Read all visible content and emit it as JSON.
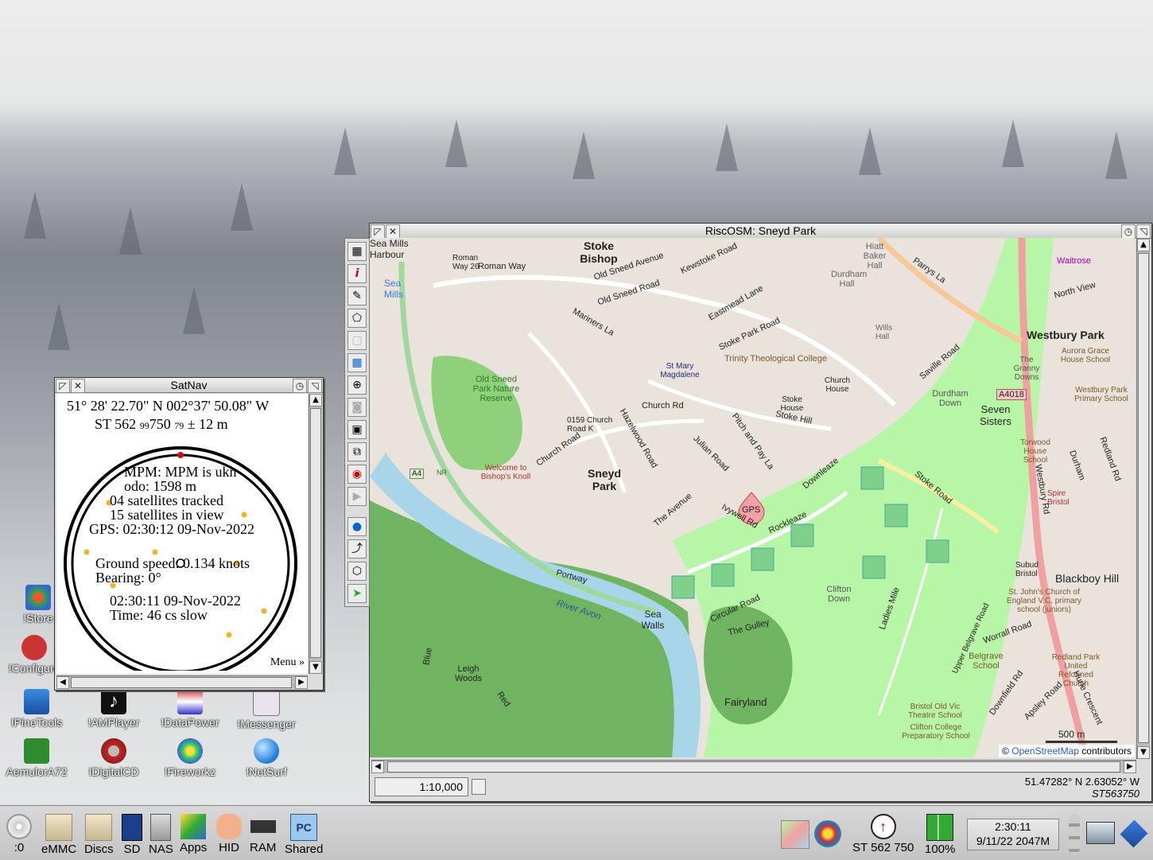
{
  "satnav": {
    "title": "SatNav",
    "coords": "51° 28' 22.70\" N  002°37' 50.08\" W",
    "grid_prefix": "ST 562",
    "grid_small1": "99",
    "grid_mid": "750",
    "grid_small2": "79",
    "grid_suffix": "±  12 m",
    "mpm": "MPM:   MPM is ukn",
    "odo": "odo:      1598 m",
    "tracked": "04 satellites tracked",
    "inview": "15 satellites in view",
    "gps": "GPS: 02:30:12 09-Nov-2022",
    "speed": "Ground speed: 0.134 knots",
    "bearing": "Bearing:     0°",
    "clock": "02:30:11 09-Nov-2022",
    "time": "Time:     46 cs slow",
    "menu": "Menu »"
  },
  "map_window": {
    "title": "RiscOSM: Sneyd Park",
    "scale": "1:10,000",
    "lat_lon": "51.47282° N  2.63052° W",
    "grid_ref": "ST563750",
    "attribution_prefix": "©",
    "attribution_link": "OpenStreetMap",
    "attribution_suffix": "contributors",
    "scale_bar": "500 m",
    "gps_marker": "GPS",
    "labels": {
      "stoke_bishop": "Stoke Bishop",
      "sea_mills_harbour": "Sea Mills Harbour",
      "sea_mills": "Sea Mills",
      "roman_way": "Roman Way",
      "roman_way_26": "Roman Way 26",
      "old_sneed_avenue": "Old Sneed Avenue",
      "old_sneed_road": "Old Sneed Road",
      "kewstoke_road": "Kewstoke Road",
      "durdham_hall": "Durdham Hall",
      "hiatt_baker_hall": "Hiatt Baker Hall",
      "waitrose": "Waitrose",
      "parrys_la": "Parrys La",
      "north_view": "North View",
      "westbury_park": "Westbury Park",
      "mariners": "Mariners La",
      "eastmead_lane": "Eastmead Lane",
      "stoke_park_road": "Stoke Park Road",
      "trinity": "Trinity Theological College",
      "church_rd": "Church Rd",
      "stoke_hill": "Stoke Hill",
      "saville_road": "Saville Road",
      "durdham_down": "Durdham Down",
      "seven_sisters": "Seven Sisters",
      "aurora": "Aurora Grace House School",
      "westbury_primary": "Westbury Park Primary School",
      "a4018": "A4018",
      "old_sneed_park": "Old Sneed Park Nature Reserve",
      "sneyd_park": "Sneyd Park",
      "church_road": "Church Road",
      "hazelwood": "Hazelwood Road",
      "pitch_pay": "Pitch and Pay La",
      "julian_road": "Julian Road",
      "downleaze": "Downleaze",
      "stoke_road": "Stoke Road",
      "torwood": "Torwood House School",
      "spire": "Spire Bristol",
      "the_avenue": "The Avenue",
      "ivywell": "Ivywell Rd",
      "rockleaze": "Rockleaze",
      "clifton_down": "Clifton Down",
      "ladies_mile": "Ladies Mile",
      "subud": "Subud Bristol",
      "blackboy": "Blackboy Hill",
      "st_johns": "St. John's Church of England V.C. primary school (juniors)",
      "portway": "Portway",
      "river_avon": "River Avon",
      "sea_walls": "Sea Walls",
      "circular_road": "Circular Road",
      "the_gulley": "The Gulley",
      "fairyland": "Fairyland",
      "leigh_woods": "Leigh Woods",
      "blue": "Blue",
      "red": "Red",
      "bishops_knoll": "Welcome to Bishop's Knoll",
      "worrall": "Worrall Road",
      "belgrave": "Belgrave School",
      "redland_park": "Redland Park United Reformed Church",
      "upper_belgrave": "Upper Belgrave Road",
      "bristol_old_vic": "Bristol Old Vic Theatre School",
      "clifton_college": "Clifton College Preparatory School",
      "a4": "A4",
      "stoke_house": "Stoke House",
      "church_house": "Church House",
      "st_mary": "St Mary Magdalene",
      "wills_hall": "Wills Hall",
      "the_granny": "The Granny Downs",
      "durham": "Durham",
      "redland_rd": "Redland Rd",
      "westbury_rd": "Westbury Rd",
      "hurle": "Hurle Crescent",
      "apsley": "Apsley Road",
      "downfield": "Downfield Rd",
      "church_0159": "0159 Church Road K",
      "nr": "NR"
    }
  },
  "desktop_icons": [
    {
      "label": "!Store"
    },
    {
      "label": "!Configure"
    },
    {
      "label": "!PineTools"
    },
    {
      "label": "!AMPlayer"
    },
    {
      "label": "!DataPower"
    },
    {
      "label": "!Messenger"
    },
    {
      "label": "AemulorA72"
    },
    {
      "label": "!DigitalCD"
    },
    {
      "label": "!Fireworkz"
    },
    {
      "label": "!NetSurf"
    }
  ],
  "iconbar": {
    "left": [
      {
        "label": ":0"
      },
      {
        "label": "eMMC"
      },
      {
        "label": "Discs"
      },
      {
        "label": "SD"
      },
      {
        "label": "NAS"
      },
      {
        "label": "Apps"
      },
      {
        "label": "HID"
      },
      {
        "label": "RAM"
      },
      {
        "label": "Shared"
      }
    ],
    "grid_ref": "ST 562 750",
    "battery": "100%",
    "clock_time": "2:30:11",
    "clock_date": "9/11/22 2047M"
  },
  "colors": {
    "park": "#b7f5a7",
    "woods": "#6fb460",
    "river": "#a8d6e8",
    "urban": "#e4dcd4",
    "road": "#ffffff",
    "a_road": "#f0a0a0",
    "satellite": "#f2b320",
    "north_marker": "#cc1111"
  }
}
